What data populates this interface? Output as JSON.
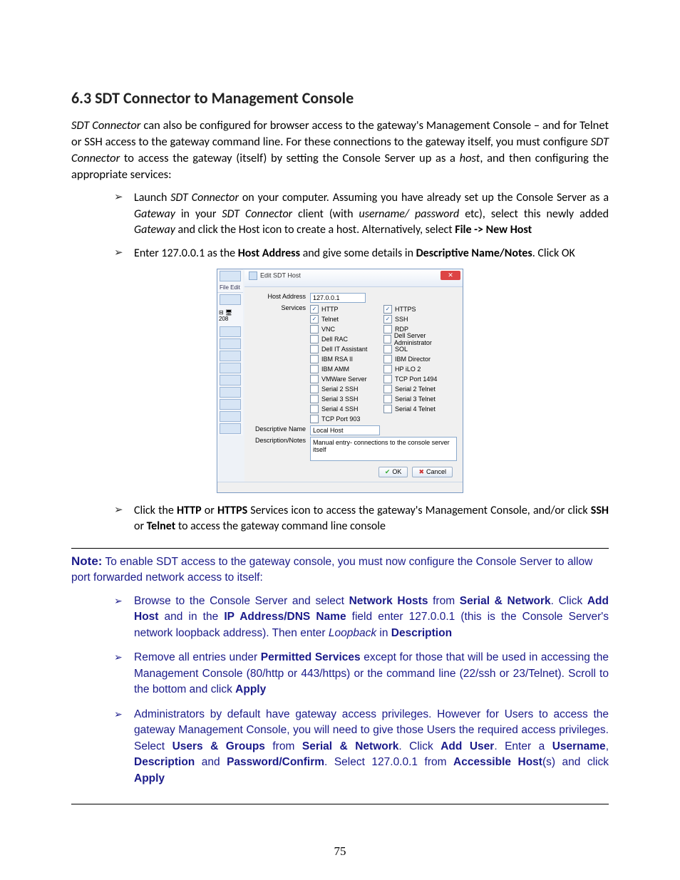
{
  "heading": "6.3    SDT Connector to Management Console",
  "intro": {
    "p1a": "SDT Connector",
    "p1b": " can also be configured for browser access to the gateway's Management Console – and for Telnet or SSH access to the gateway command line. For these connections to the gateway itself, you must configure ",
    "p1c": "SDT Connector",
    "p1d": " to access the gateway (itself) by setting the Console Server up as a ",
    "p1e": "host",
    "p1f": ", and then configuring the appropriate services:"
  },
  "bullets1": {
    "b1a": "Launch ",
    "b1b": "SDT Connector",
    "b1c": " on your computer. Assuming you have already set up the Console Server as a ",
    "b1d": "Gateway",
    "b1e": " in your ",
    "b1f": "SDT Connector",
    "b1g": " client (with ",
    "b1h": "username/ password",
    "b1i": " etc), select this newly added ",
    "b1j": "Gateway",
    "b1k": " and click the Host icon to create a host. Alternatively, select ",
    "b1l": "File -> New Host",
    "b2a": "Enter 127.0.0.1 as the ",
    "b2b": "Host Address",
    "b2c": " and give some details in ",
    "b2d": "Descriptive Name/Notes",
    "b2e": ". Click OK"
  },
  "dialog": {
    "title": "Edit SDT Host",
    "sidebar_menu": "File   Edit",
    "tree_root": "208",
    "labels": {
      "host_address": "Host Address",
      "services": "Services",
      "desc_name": "Descriptive Name",
      "desc_notes": "Description/Notes"
    },
    "host_address": "127.0.0.1",
    "desc_name": "Local Host",
    "desc_notes": "Manual entry- connections to the console server itself",
    "services_left": [
      {
        "label": "HTTP",
        "checked": true
      },
      {
        "label": "Telnet",
        "checked": true
      },
      {
        "label": "VNC",
        "checked": false
      },
      {
        "label": "Dell RAC",
        "checked": false
      },
      {
        "label": "Dell IT Assistant",
        "checked": false
      },
      {
        "label": "IBM RSA II",
        "checked": false
      },
      {
        "label": "IBM AMM",
        "checked": false
      },
      {
        "label": "VMWare Server",
        "checked": false
      },
      {
        "label": "Serial 2 SSH",
        "checked": false
      },
      {
        "label": "Serial 3 SSH",
        "checked": false
      },
      {
        "label": "Serial 4 SSH",
        "checked": false
      },
      {
        "label": "TCP Port 903",
        "checked": false
      }
    ],
    "services_right": [
      {
        "label": "HTTPS",
        "checked": true
      },
      {
        "label": "SSH",
        "checked": true
      },
      {
        "label": "RDP",
        "checked": false
      },
      {
        "label": "Dell Server Administrator",
        "checked": false
      },
      {
        "label": "SOL",
        "checked": false
      },
      {
        "label": "IBM Director",
        "checked": false
      },
      {
        "label": "HP iLO 2",
        "checked": false
      },
      {
        "label": "TCP Port 1494",
        "checked": false
      },
      {
        "label": "Serial 2 Telnet",
        "checked": false
      },
      {
        "label": "Serial 3 Telnet",
        "checked": false
      },
      {
        "label": "Serial 4 Telnet",
        "checked": false
      }
    ],
    "ok": "OK",
    "cancel": "Cancel"
  },
  "bullets2": {
    "b1a": "Click the ",
    "b1b": "HTTP",
    "b1c": " or ",
    "b1d": "HTTPS",
    "b1e": " Services icon to access the gateway's Management Console, and/or click ",
    "b1f": "SSH",
    "b1g": " or ",
    "b1h": "Telnet",
    "b1i": " to access the gateway command line console"
  },
  "note": {
    "label": "Note:",
    "intro": " To enable SDT access to the gateway console, you must now configure the Console Server to allow port forwarded network access to itself:",
    "n1a": "Browse to the Console Server and select ",
    "n1b": "Network Hosts",
    "n1c": " from ",
    "n1d": "Serial & Network",
    "n1e": ". Click ",
    "n1f": "Add Host",
    "n1g": " and in the ",
    "n1h": "IP Address/DNS Name",
    "n1i": " field enter 127.0.0.1 (this is the Console Server's network loopback address). Then enter ",
    "n1j": "Loopback",
    "n1k": " in ",
    "n1l": "Description",
    "n2a": "Remove all entries under ",
    "n2b": "Permitted Services",
    "n2c": " except for those that will be used in accessing the Management Console (80/http or 443/https) or the command line (22/ssh or 23/Telnet). Scroll to the bottom and click ",
    "n2d": "Apply",
    "n3a": "Administrators by default have gateway access privileges. However for Users to access the gateway Management Console, you will need to give those Users the required access privileges. Select ",
    "n3b": "Users & Groups",
    "n3c": " from ",
    "n3d": "Serial & Network",
    "n3e": ". Click ",
    "n3f": "Add User",
    "n3g": ". Enter a ",
    "n3h": "Username",
    "n3i": ", ",
    "n3j": "Description",
    "n3k": " and ",
    "n3l": "Password/Confirm",
    "n3m": ". Select 127.0.0.1 from ",
    "n3n": "Accessible Host",
    "n3o": "(s) and click ",
    "n3p": "Apply"
  },
  "page_number": "75"
}
